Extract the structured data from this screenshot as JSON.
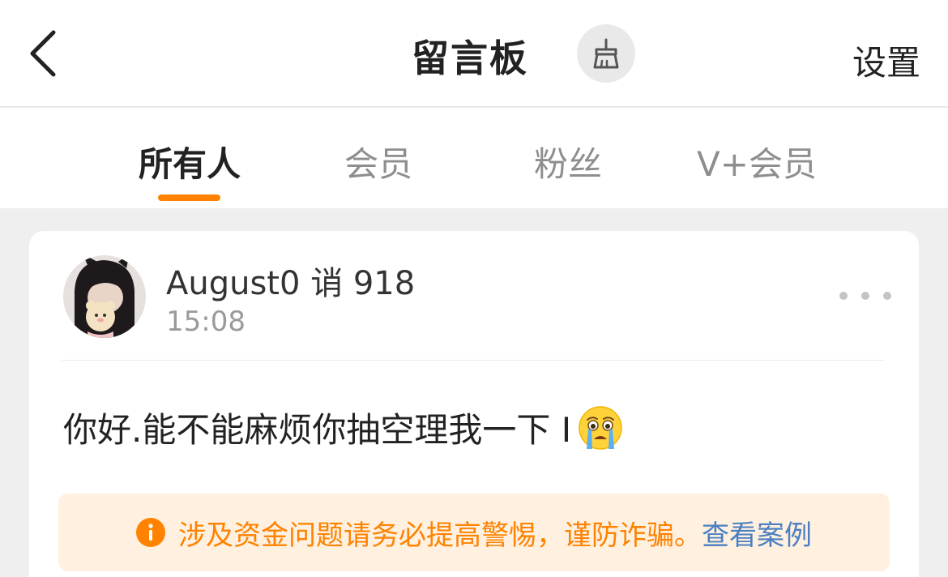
{
  "header": {
    "title": "留言板",
    "settings_label": "设置",
    "back_icon": "chevron-left-icon",
    "clean_icon": "broom-icon"
  },
  "tabs": [
    {
      "label": "所有人",
      "active": true
    },
    {
      "label": "会员",
      "active": false
    },
    {
      "label": "粉丝",
      "active": false
    },
    {
      "label": "V+会员",
      "active": false
    }
  ],
  "message": {
    "username": "August0 诮 918",
    "time": "15:08",
    "text": "你好.能不能麻烦你抽空理我一下 I",
    "emoji": "crying-face-emoji",
    "more_icon": "more-dots-icon"
  },
  "warning": {
    "text": "涉及资金问题请务必提高警惕，谨防诈骗。",
    "link": "查看案例",
    "icon": "info-icon"
  },
  "colors": {
    "accent": "#ff8200",
    "link": "#4a7fc1",
    "warning_bg": "#fff0e0",
    "page_bg": "#efefef"
  }
}
